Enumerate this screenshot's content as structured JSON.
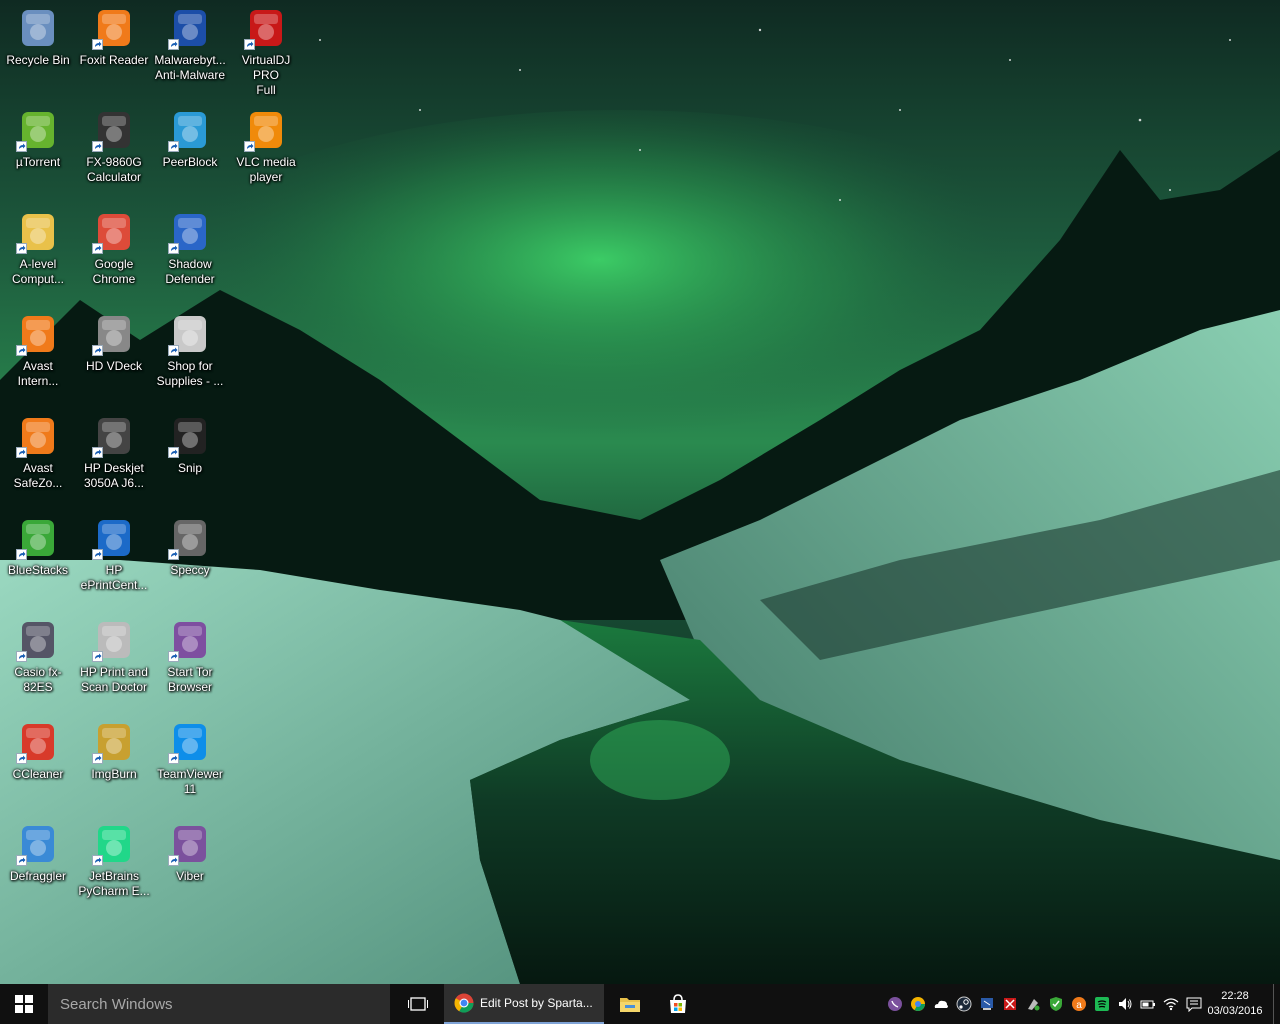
{
  "desktop": {
    "icons": [
      {
        "label": "Recycle Bin",
        "name": "recycle-bin-icon",
        "shortcut": false,
        "color": "#6a8fbf"
      },
      {
        "label": "Foxit Reader",
        "name": "foxit-reader-icon",
        "shortcut": true,
        "color": "#f07a1a"
      },
      {
        "label": "Malwarebyt...\nAnti-Malware",
        "name": "malwarebytes-icon",
        "shortcut": true,
        "color": "#1c4ea8"
      },
      {
        "label": "VirtualDJ PRO\nFull",
        "name": "virtualdj-icon",
        "shortcut": true,
        "color": "#c81818"
      },
      {
        "label": "µTorrent",
        "name": "utorrent-icon",
        "shortcut": true,
        "color": "#66b32e"
      },
      {
        "label": "FX-9860G\nCalculator",
        "name": "calculator-icon",
        "shortcut": true,
        "color": "#333333"
      },
      {
        "label": "PeerBlock",
        "name": "peerblock-icon",
        "shortcut": true,
        "color": "#2a9ad6"
      },
      {
        "label": "VLC media\nplayer",
        "name": "vlc-icon",
        "shortcut": true,
        "color": "#f08a0a"
      },
      {
        "label": "A-level\nComput...",
        "name": "folder-icon",
        "shortcut": true,
        "color": "#e9c14a"
      },
      {
        "label": "Google\nChrome",
        "name": "chrome-icon",
        "shortcut": true,
        "color": "#dd4b39"
      },
      {
        "label": "Shadow\nDefender",
        "name": "shadow-defender-icon",
        "shortcut": true,
        "color": "#2a66c8"
      },
      {
        "label": "Avast\nIntern...",
        "name": "avast-icon",
        "shortcut": true,
        "color": "#f07a1a"
      },
      {
        "label": "HD VDeck",
        "name": "hd-vdeck-icon",
        "shortcut": true,
        "color": "#888888"
      },
      {
        "label": "Shop for\nSupplies - ...",
        "name": "printer-supplies-icon",
        "shortcut": true,
        "color": "#c9c9c9"
      },
      {
        "label": "Avast\nSafeZo...",
        "name": "avast-safezone-icon",
        "shortcut": true,
        "color": "#f07a1a"
      },
      {
        "label": "HP Deskjet\n3050A J6...",
        "name": "printer-icon",
        "shortcut": true,
        "color": "#444444"
      },
      {
        "label": "Snip",
        "name": "snip-icon",
        "shortcut": true,
        "color": "#222222"
      },
      {
        "label": "BlueStacks",
        "name": "bluestacks-icon",
        "shortcut": true,
        "color": "#3aa838"
      },
      {
        "label": "HP\nePrintCent...",
        "name": "hp-eprint-icon",
        "shortcut": true,
        "color": "#1c6ac8"
      },
      {
        "label": "Speccy",
        "name": "speccy-icon",
        "shortcut": true,
        "color": "#666666"
      },
      {
        "label": "Casio fx-82ES",
        "name": "casio-calculator-icon",
        "shortcut": true,
        "color": "#555566"
      },
      {
        "label": "HP Print and\nScan Doctor",
        "name": "hp-scan-doctor-icon",
        "shortcut": true,
        "color": "#bbbbbb"
      },
      {
        "label": "Start Tor\nBrowser",
        "name": "tor-browser-icon",
        "shortcut": true,
        "color": "#7e4fa0"
      },
      {
        "label": "CCleaner",
        "name": "ccleaner-icon",
        "shortcut": true,
        "color": "#d83a2a"
      },
      {
        "label": "ImgBurn",
        "name": "imgburn-icon",
        "shortcut": true,
        "color": "#c8a030"
      },
      {
        "label": "TeamViewer\n11",
        "name": "teamviewer-icon",
        "shortcut": true,
        "color": "#0e8ee9"
      },
      {
        "label": "Defraggler",
        "name": "defraggler-icon",
        "shortcut": true,
        "color": "#3a8ad6"
      },
      {
        "label": "JetBrains\nPyCharm E...",
        "name": "pycharm-icon",
        "shortcut": true,
        "color": "#21d789"
      },
      {
        "label": "Viber",
        "name": "viber-icon",
        "shortcut": true,
        "color": "#7b519d"
      }
    ]
  },
  "taskbar": {
    "search_placeholder": "Search Windows",
    "chrome_task_label": "Edit Post by Sparta...",
    "clock_time": "22:28",
    "clock_date": "03/03/2016",
    "tray_icons": [
      "viber-tray-icon",
      "chrome-tray-icon",
      "onedrive-icon",
      "steam-icon",
      "network-adapter-icon",
      "usb-icon",
      "shield-tray-icon",
      "avast-tray-icon",
      "spotify-icon",
      "volume-icon",
      "battery-icon",
      "wifi-icon",
      "action-center-icon"
    ]
  },
  "colors": {
    "taskbar_bg": "#101010",
    "search_bg": "#2b2b2b",
    "accent": "#7fa3d6"
  }
}
